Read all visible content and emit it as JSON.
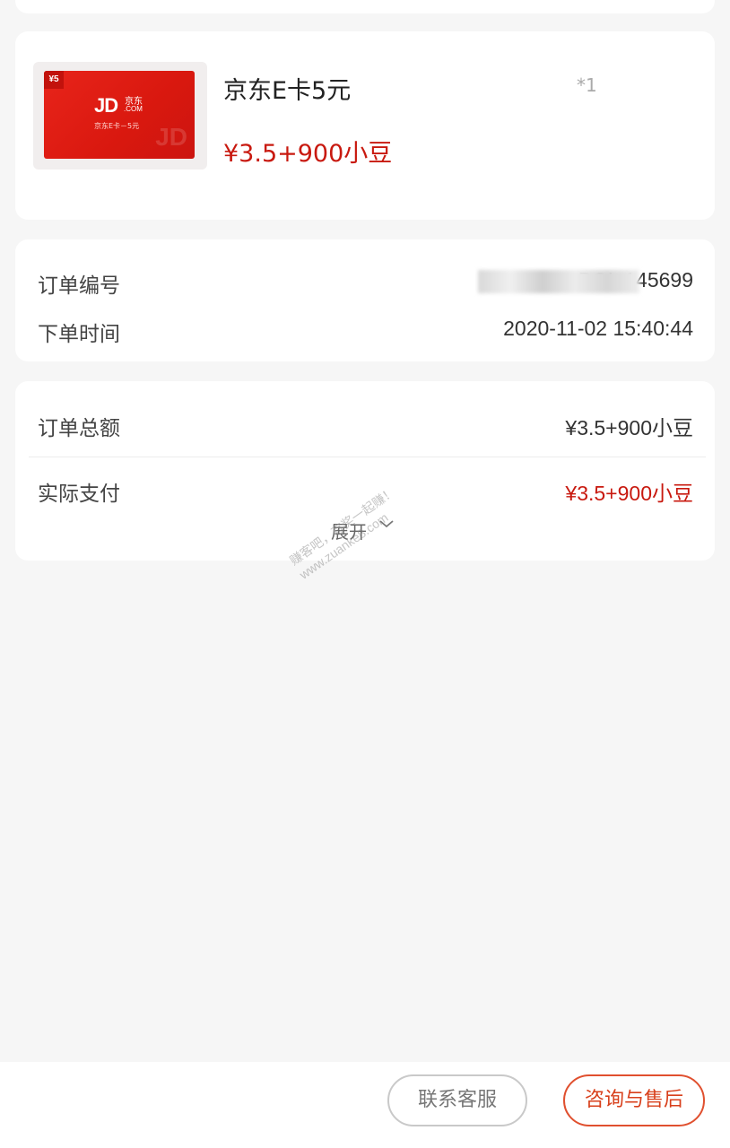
{
  "product": {
    "title": "京东E卡5元",
    "quantity": "*1",
    "price": "¥3.5+900小豆",
    "thumbnail": {
      "badge": "¥5",
      "logo": "JD",
      "logo_cn": "京东",
      "logo_com": ".COM",
      "subtitle": "京东E卡－5元",
      "watermark": "JD",
      "color": "#e8241a"
    }
  },
  "order_info": {
    "order_no_label": "订单编号",
    "order_no_value": "BOL      145699",
    "order_time_label": "下单时间",
    "order_time_value": "2020-11-02 15:40:44"
  },
  "amounts": {
    "total_label": "订单总额",
    "total_value": "¥3.5+900小豆",
    "paid_label": "实际支付",
    "paid_value": "¥3.5+900小豆",
    "expand_label": "展开"
  },
  "watermark": {
    "line1": "赚客吧，有奖一起赚！",
    "line2": "www.zuanke8.com"
  },
  "actions": {
    "customer_service": "联系客服",
    "after_sales": "咨询与售后"
  },
  "colors": {
    "accent_red": "#c8190f",
    "button_orange": "#e0502f",
    "background": "#f6f6f6"
  }
}
